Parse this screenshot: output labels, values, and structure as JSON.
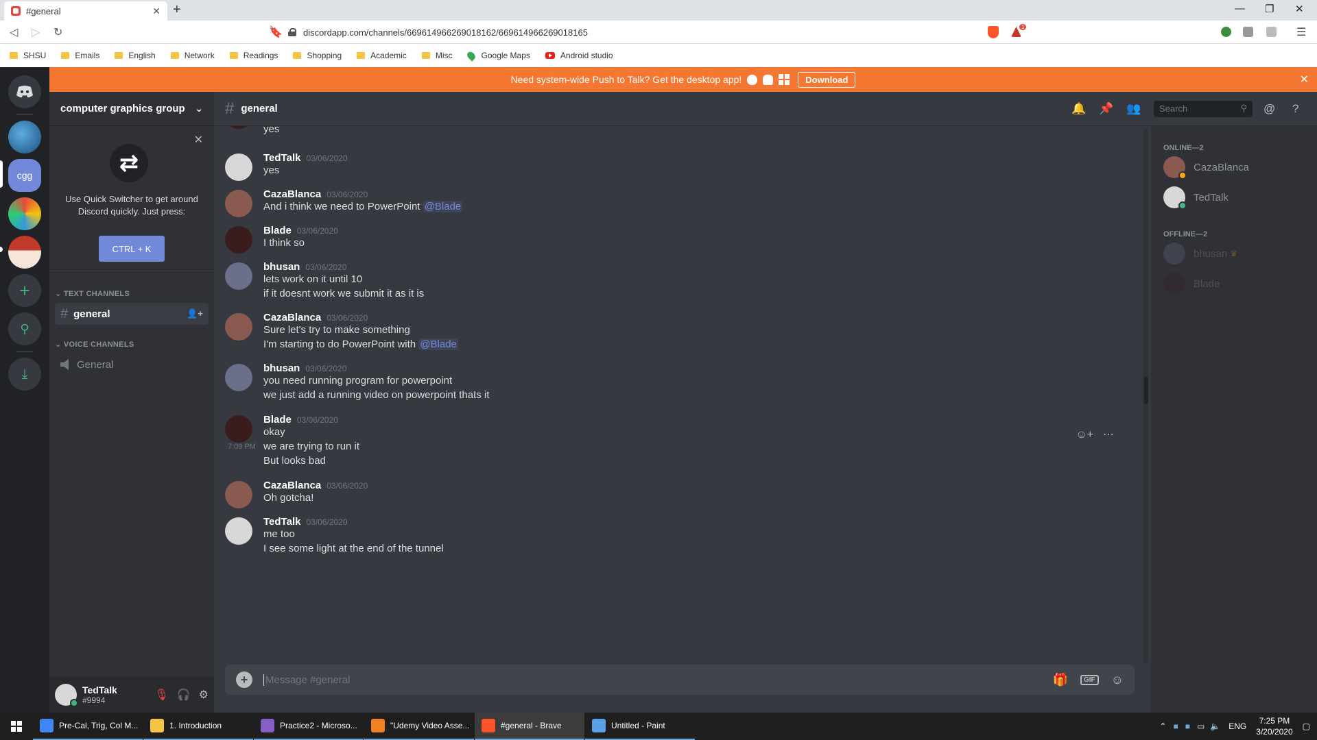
{
  "browser": {
    "tab_title": "#general",
    "url": "discordapp.com/channels/669614966269018162/669614966269018165",
    "bookmarks": [
      {
        "label": "SHSU",
        "kind": "folder"
      },
      {
        "label": "Emails",
        "kind": "folder"
      },
      {
        "label": "English",
        "kind": "folder"
      },
      {
        "label": "Network",
        "kind": "folder"
      },
      {
        "label": "Readings",
        "kind": "folder"
      },
      {
        "label": "Shopping",
        "kind": "folder"
      },
      {
        "label": "Academic",
        "kind": "folder"
      },
      {
        "label": "Misc",
        "kind": "folder"
      },
      {
        "label": "Google Maps",
        "kind": "maps"
      },
      {
        "label": "Android studio",
        "kind": "youtube"
      }
    ],
    "alert_badge": "1"
  },
  "banner": {
    "text": "Need system-wide Push to Talk? Get the desktop app!",
    "download_label": "Download"
  },
  "guilds": {
    "cgg_label": "cgg"
  },
  "sidebar": {
    "server_name": "computer graphics group",
    "quick_switcher_text": "Use Quick Switcher to get around Discord quickly. Just press:",
    "quick_switcher_key": "CTRL + K",
    "text_category": "TEXT CHANNELS",
    "voice_category": "VOICE CHANNELS",
    "text_channel": "general",
    "voice_channel": "General"
  },
  "user": {
    "name": "TedTalk",
    "tag": "#9994"
  },
  "header": {
    "channel": "general",
    "search_placeholder": "Search"
  },
  "messages": [
    {
      "lines": [
        "yes"
      ],
      "partial": true
    },
    {
      "author": "TedTalk",
      "date": "03/06/2020",
      "lines": [
        "yes"
      ],
      "avatar_color": "#d8d8d8"
    },
    {
      "author": "CazaBlanca",
      "date": "03/06/2020",
      "lines": [
        "And i think we need to PowerPoint"
      ],
      "mention": "@Blade",
      "avatar_color": "#8a5a50"
    },
    {
      "author": "Blade",
      "date": "03/06/2020",
      "lines": [
        "I think so"
      ],
      "avatar_color": "#3a1c1c"
    },
    {
      "author": "bhusan",
      "date": "03/06/2020",
      "lines": [
        "lets work on it until 10",
        "if it doesnt work we submit it as it is"
      ],
      "avatar_color": "#6a6f8a"
    },
    {
      "author": "CazaBlanca",
      "date": "03/06/2020",
      "lines": [
        "Sure let's try to make something",
        "I'm starting to do PowerPoint with"
      ],
      "mention": "@Blade",
      "avatar_color": "#8a5a50"
    },
    {
      "author": "bhusan",
      "date": "03/06/2020",
      "lines": [
        "you need running program for powerpoint",
        "we just add a running video on powerpoint thats it"
      ],
      "avatar_color": "#6a6f8a"
    },
    {
      "author": "Blade",
      "date": "03/06/2020",
      "lines": [
        "okay",
        "we are trying to run it",
        "But looks bad"
      ],
      "hover_time": "7:09 PM",
      "avatar_color": "#3a1c1c"
    },
    {
      "author": "CazaBlanca",
      "date": "03/06/2020",
      "lines": [
        "Oh gotcha!"
      ],
      "avatar_color": "#8a5a50"
    },
    {
      "author": "TedTalk",
      "date": "03/06/2020",
      "lines": [
        "me too",
        "I see some light at the end of the tunnel"
      ],
      "avatar_color": "#d8d8d8"
    }
  ],
  "composer": {
    "placeholder": "Message #general",
    "gif_label": "GIF"
  },
  "members": {
    "online_header": "ONLINE—2",
    "offline_header": "OFFLINE—2",
    "online": [
      {
        "name": "CazaBlanca",
        "status": "idle",
        "status_color": "#faa61a"
      },
      {
        "name": "TedTalk",
        "status": "online",
        "status_color": "#43b581"
      }
    ],
    "offline": [
      {
        "name": "bhusan",
        "owner": true
      },
      {
        "name": "Blade"
      }
    ]
  },
  "taskbar": {
    "items": [
      {
        "label": "Pre-Cal, Trig, Col M...",
        "color": "#4285f4"
      },
      {
        "label": "1. Introduction",
        "color": "#f4c542"
      },
      {
        "label": "Practice2 - Microso...",
        "color": "#865fc5"
      },
      {
        "label": "\"Udemy Video Asse...",
        "color": "#f48024"
      },
      {
        "label": "#general - Brave",
        "color": "#fb542b"
      },
      {
        "label": "Untitled - Paint",
        "color": "#5aa0e6"
      }
    ],
    "lang": "ENG",
    "time": "7:25 PM",
    "date": "3/20/2020"
  },
  "colors": {
    "blurple": "#7289da",
    "banner": "#f57731",
    "bg_chat": "#36393f",
    "bg_sidebar": "#2f3136",
    "bg_guilds": "#202225"
  }
}
